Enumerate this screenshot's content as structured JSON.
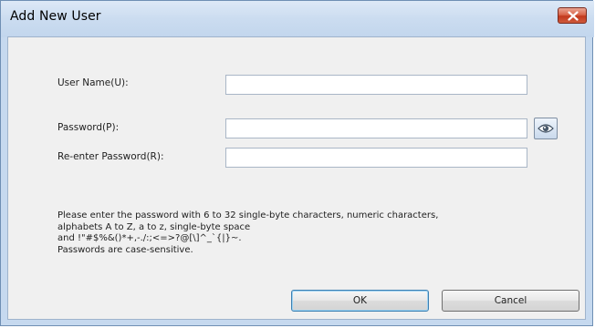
{
  "window": {
    "title": "Add New User"
  },
  "form": {
    "user_name_label": "User Name(U):",
    "user_name_value": "",
    "password_label": "Password(P):",
    "password_value": "",
    "reenter_label": "Re-enter Password(R):",
    "reenter_value": ""
  },
  "info": {
    "line1": "Please enter the password with 6 to 32 single-byte characters, numeric characters,",
    "line2": "alphabets A to Z, a to z, single-byte space",
    "line3": "and !\"#$%&()*+,-./:;<=>?@[\\]^_`{|}~.",
    "line4": "Passwords are case-sensitive."
  },
  "buttons": {
    "ok_label": "OK",
    "cancel_label": "Cancel"
  },
  "icons": {
    "close": "close-icon",
    "show_password": "eye-icon"
  },
  "colors": {
    "titlebar": "#c6d9ef",
    "close_button": "#c2391e",
    "client_background": "#f0f0f0"
  }
}
